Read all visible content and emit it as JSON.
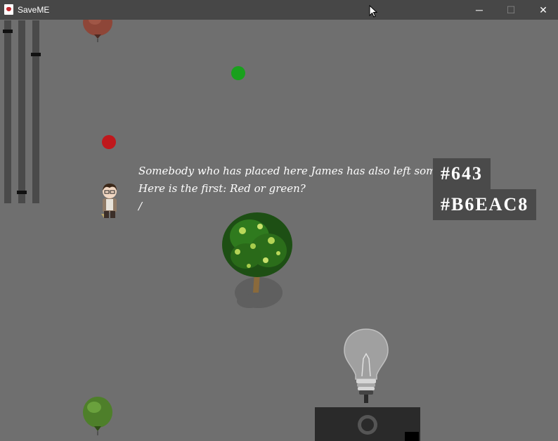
{
  "window": {
    "title": "SaveME",
    "minimize": "─",
    "maximize": "☐",
    "close": "✕"
  },
  "sliders": [
    {
      "name": "slider-1",
      "level": 0.95
    },
    {
      "name": "slider-2",
      "level": 0.05
    },
    {
      "name": "slider-3",
      "level": 0.82
    }
  ],
  "dialogue": {
    "line1": "Somebody who has placed here James has also left some tips.",
    "line2": "Here is the first: Red or green?",
    "cursor": "/"
  },
  "codes": {
    "code1": "#643",
    "code2": "#B6EAC8"
  },
  "colors": {
    "red_dot": "#c0181c",
    "green_dot": "#19a01d",
    "yellow_dot": "#c8c21e",
    "background": "#6f6f6f"
  },
  "icons": [
    "app-icon",
    "balloon-red-icon",
    "balloon-green-icon",
    "character-icon",
    "tree-icon",
    "lightbulb-icon",
    "cursor-icon"
  ]
}
